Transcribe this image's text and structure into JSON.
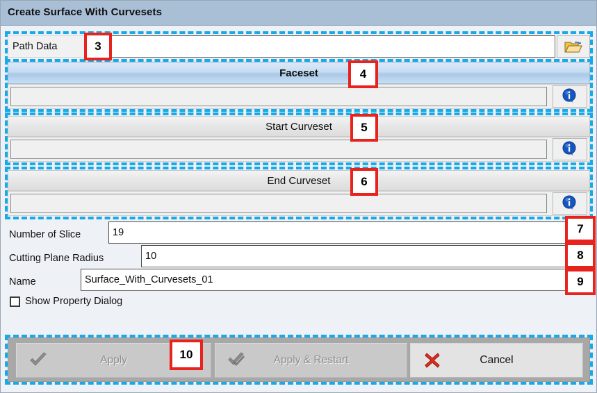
{
  "window": {
    "title": "Create Surface With Curvesets"
  },
  "path_row": {
    "label": "Path Data",
    "value": "",
    "browse_icon": "folder-open-icon"
  },
  "sections": [
    {
      "header": "Faceset",
      "style": "blue",
      "value": "",
      "info_icon": "info-icon"
    },
    {
      "header": "Start Curveset",
      "style": "gray",
      "value": "",
      "info_icon": "info-icon"
    },
    {
      "header": "End Curveset",
      "style": "gray",
      "value": "",
      "info_icon": "info-icon"
    }
  ],
  "fields": [
    {
      "label": "Number of Slice",
      "value": "19"
    },
    {
      "label": "Cutting Plane Radius",
      "value": "10"
    },
    {
      "label": "Name",
      "value": "Surface_With_Curvesets_01"
    }
  ],
  "checkbox": {
    "label": "Show Property Dialog",
    "checked": false
  },
  "buttons": [
    {
      "label": "Apply",
      "icon": "check-icon",
      "enabled": false
    },
    {
      "label": "Apply & Restart",
      "icon": "double-check-icon",
      "enabled": false
    },
    {
      "label": "Cancel",
      "icon": "red-x-icon",
      "enabled": true
    }
  ],
  "callouts": [
    {
      "number": "3"
    },
    {
      "number": "4"
    },
    {
      "number": "5"
    },
    {
      "number": "6"
    },
    {
      "number": "7"
    },
    {
      "number": "8"
    },
    {
      "number": "9"
    },
    {
      "number": "10"
    }
  ],
  "colors": {
    "titlebar": "#a9bfd6",
    "focus_dash": "#18a9e8",
    "callout_red": "#e8221c",
    "info_blue": "#1556c0",
    "folder_gold": "#f2c14a"
  }
}
